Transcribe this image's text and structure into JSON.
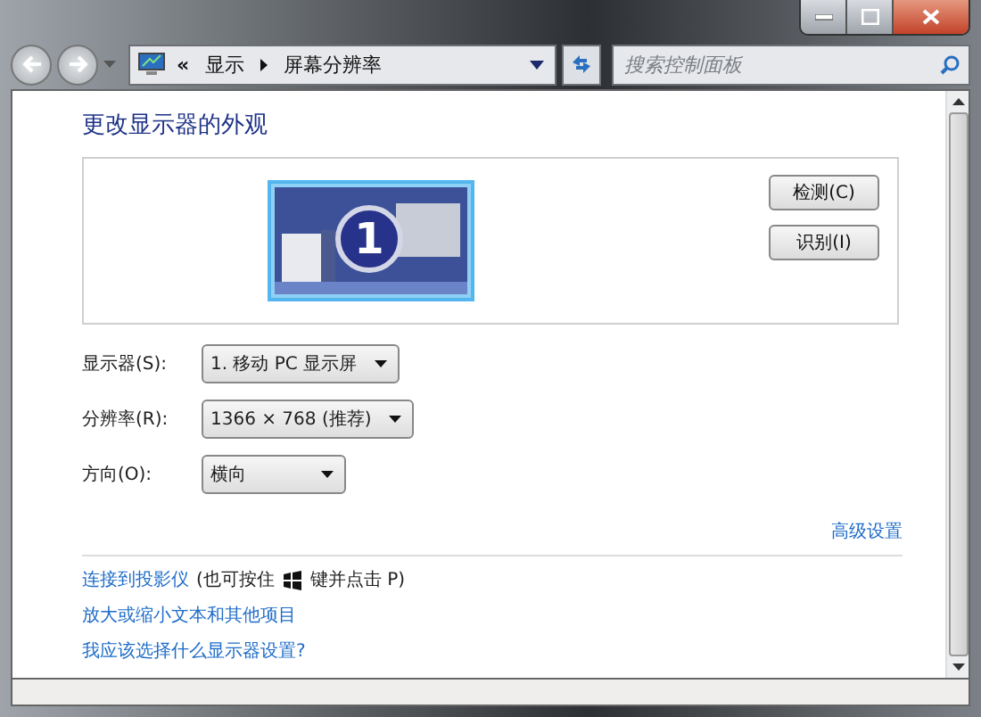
{
  "address_bar": {
    "overflow": "«",
    "crumbs": [
      "显示",
      "屏幕分辨率"
    ]
  },
  "search": {
    "placeholder": "搜索控制面板"
  },
  "title": "更改显示器的外观",
  "monitor_preview": {
    "number": "1",
    "selected": true
  },
  "buttons": [
    "检测(C)",
    "识别(I)"
  ],
  "settings": [
    {
      "label": "显示器(S):",
      "value": "1. 移动 PC 显示屏"
    },
    {
      "label": "分辨率(R):",
      "value": "1366 × 768 (推荐)"
    },
    {
      "label": "方向(O):",
      "value": "横向"
    }
  ],
  "advanced_link": "高级设置",
  "projector": {
    "link": "连接到投影仪",
    "hint_before": "(也可按住",
    "hint_after": "键并点击 P)"
  },
  "links": [
    "放大或缩小文本和其他项目",
    "我应该选择什么显示器设置?"
  ]
}
